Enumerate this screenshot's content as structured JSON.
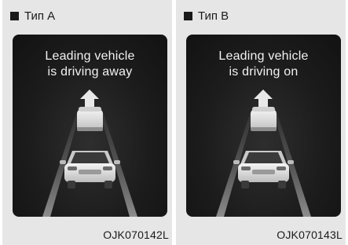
{
  "panels": [
    {
      "label": "Тип A",
      "message_line1": "Leading vehicle",
      "message_line2": "is driving away",
      "code": "OJK070142L"
    },
    {
      "label": "Тип B",
      "message_line1": "Leading vehicle",
      "message_line2": "is driving on",
      "code": "OJK070143L"
    }
  ],
  "icons": {
    "bullet": "square-bullet-icon",
    "arrow": "arrow-up-icon",
    "leading_vehicle": "leading-vehicle-icon",
    "own_vehicle": "own-car-icon"
  },
  "colors": {
    "panel_bg": "#e6e6e6",
    "screen_bg": "#1c1c1c",
    "screen_text": "#f2f2f2"
  }
}
